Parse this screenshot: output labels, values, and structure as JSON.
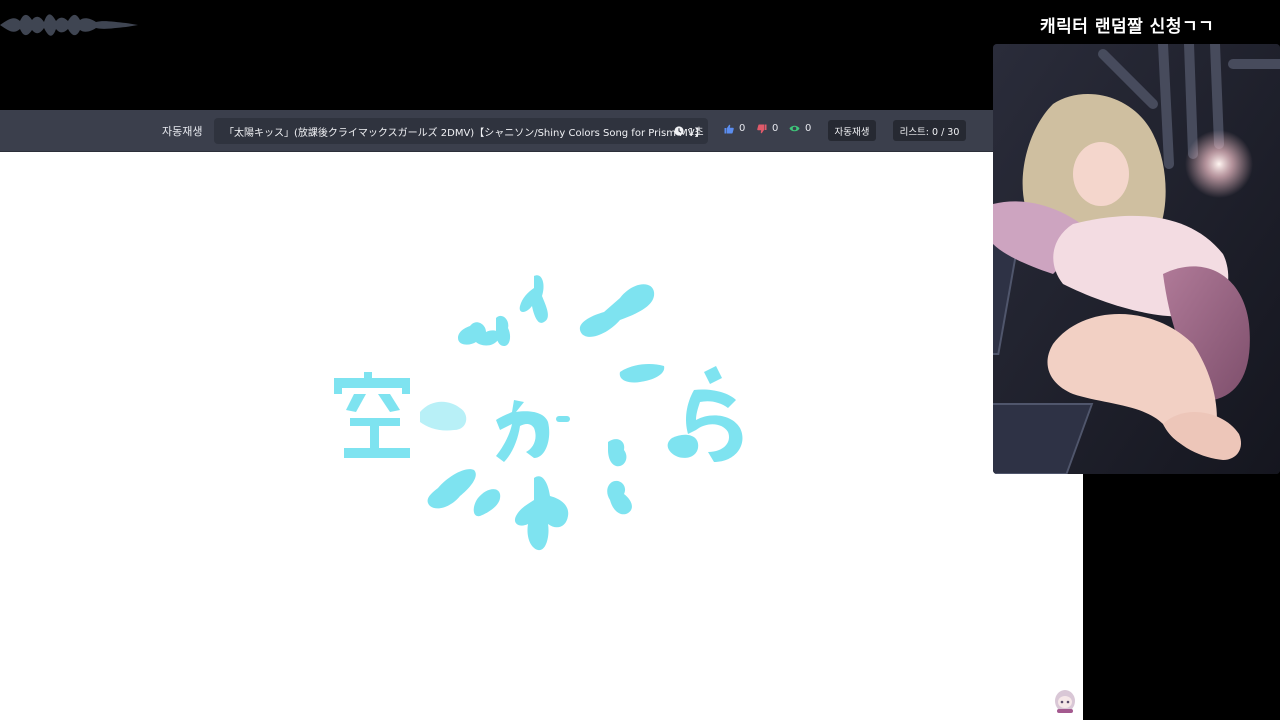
{
  "overlay": {
    "request_title": "캐릭터 랜덤짤 신청ㄱㄱ"
  },
  "player": {
    "autoplay_label": "자동재생",
    "now_playing": "「太陽キッス」(放課後クライマックスガールズ 2DMV)【シャニソン/Shiny Colors Song for Prism MV】",
    "duration": "1초",
    "likes": "0",
    "dislikes": "0",
    "views": "0",
    "autoplay_button": "자동재생",
    "list_button": "리스트: 0 / 30"
  },
  "video": {
    "title_art_text": "空から"
  },
  "colors": {
    "bar_bg": "#3b3f4c",
    "button_bg": "#262932",
    "like_icon": "#5b8def",
    "dislike_icon": "#e05a6a",
    "views_icon": "#3ec77a",
    "art_cyan": "#7ee3f0"
  }
}
